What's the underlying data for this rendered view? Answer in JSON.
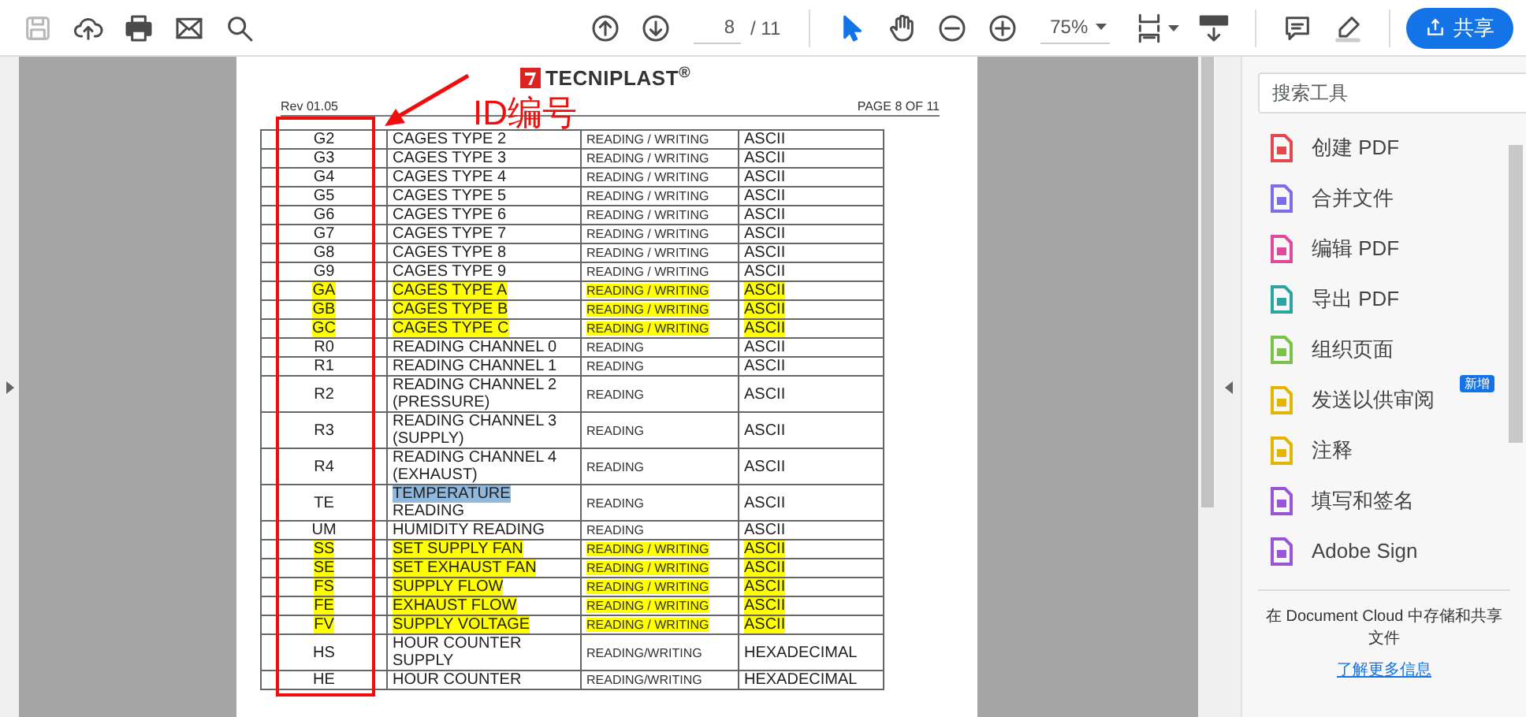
{
  "toolbar": {
    "save": {
      "disabled": true
    },
    "modes": [
      {
        "kind": "pointer",
        "selected": true
      },
      {
        "kind": "hand",
        "selected": false
      }
    ],
    "page_number": "8",
    "page_total": "/ 11",
    "zoom": "75%",
    "share": "共享"
  },
  "document": {
    "logo": "TECNIPLAST$^{®}$",
    "revision": "Rev 01.05",
    "page_label": "PAGE 8 OF 11",
    "annotation": {
      "label": "ID编号"
    },
    "rows": [
      {
        "id": "G2",
        "description": [
          "CAGES TYPE 2"
        ],
        "access": "READING / WRITING",
        "format": "ASCII",
        "highlighted": false,
        "text_selected": false
      },
      {
        "id": "G3",
        "description": [
          "CAGES TYPE 3"
        ],
        "access": "READING / WRITING",
        "format": "ASCII",
        "highlighted": false,
        "text_selected": false
      },
      {
        "id": "G4",
        "description": [
          "CAGES TYPE 4"
        ],
        "access": "READING / WRITING",
        "format": "ASCII",
        "highlighted": false,
        "text_selected": false
      },
      {
        "id": "G5",
        "description": [
          "CAGES TYPE 5"
        ],
        "access": "READING / WRITING",
        "format": "ASCII",
        "highlighted": false,
        "text_selected": false
      },
      {
        "id": "G6",
        "description": [
          "CAGES TYPE 6"
        ],
        "access": "READING / WRITING",
        "format": "ASCII",
        "highlighted": false,
        "text_selected": false
      },
      {
        "id": "G7",
        "description": [
          "CAGES TYPE 7"
        ],
        "access": "READING / WRITING",
        "format": "ASCII",
        "highlighted": false,
        "text_selected": false
      },
      {
        "id": "G8",
        "description": [
          "CAGES TYPE 8"
        ],
        "access": "READING / WRITING",
        "format": "ASCII",
        "highlighted": false,
        "text_selected": false
      },
      {
        "id": "G9",
        "description": [
          "CAGES TYPE 9"
        ],
        "access": "READING / WRITING",
        "format": "ASCII",
        "highlighted": false,
        "text_selected": false
      },
      {
        "id": "GA",
        "description": [
          "CAGES TYPE A"
        ],
        "access": "READING / WRITING",
        "format": "ASCII",
        "highlighted": true,
        "text_selected": false
      },
      {
        "id": "GB",
        "description": [
          "CAGES TYPE B"
        ],
        "access": "READING / WRITING",
        "format": "ASCII",
        "highlighted": true,
        "text_selected": false
      },
      {
        "id": "GC",
        "description": [
          "CAGES TYPE C"
        ],
        "access": "READING / WRITING",
        "format": "ASCII",
        "highlighted": true,
        "text_selected": false
      },
      {
        "id": "R0",
        "description": [
          "READING CHANNEL 0"
        ],
        "access": "READING",
        "format": "ASCII",
        "highlighted": false,
        "text_selected": false
      },
      {
        "id": "R1",
        "description": [
          "READING CHANNEL 1"
        ],
        "access": "READING",
        "format": "ASCII",
        "highlighted": false,
        "text_selected": false
      },
      {
        "id": "R2",
        "description": [
          "READING CHANNEL 2",
          "(PRESSURE)"
        ],
        "access": "READING",
        "format": "ASCII",
        "highlighted": false,
        "text_selected": false
      },
      {
        "id": "R3",
        "description": [
          "READING CHANNEL 3",
          "(SUPPLY)"
        ],
        "access": "READING",
        "format": "ASCII",
        "highlighted": false,
        "text_selected": false
      },
      {
        "id": "R4",
        "description": [
          "READING CHANNEL 4",
          "(EXHAUST)"
        ],
        "access": "READING",
        "format": "ASCII",
        "highlighted": false,
        "text_selected": false
      },
      {
        "id": "TE",
        "description": [
          "TEMPERATURE",
          "READING"
        ],
        "access": "READING",
        "format": "ASCII",
        "highlighted": false,
        "text_selected": true
      },
      {
        "id": "UM",
        "description": [
          "HUMIDITY READING"
        ],
        "access": "READING",
        "format": "ASCII",
        "highlighted": false,
        "text_selected": false
      },
      {
        "id": "SS",
        "description": [
          "SET SUPPLY FAN"
        ],
        "access": "READING / WRITING",
        "format": "ASCII",
        "highlighted": true,
        "text_selected": false
      },
      {
        "id": "SE",
        "description": [
          "SET EXHAUST FAN"
        ],
        "access": "READING / WRITING",
        "format": "ASCII",
        "highlighted": true,
        "text_selected": false
      },
      {
        "id": "FS",
        "description": [
          "SUPPLY FLOW"
        ],
        "access": "READING / WRITING",
        "format": "ASCII",
        "highlighted": true,
        "text_selected": false
      },
      {
        "id": "FE",
        "description": [
          "EXHAUST FLOW"
        ],
        "access": "READING / WRITING",
        "format": "ASCII",
        "highlighted": true,
        "text_selected": false
      },
      {
        "id": "FV",
        "description": [
          "SUPPLY VOLTAGE"
        ],
        "access": "READING / WRITING",
        "format": "ASCII",
        "highlighted": true,
        "text_selected": false
      },
      {
        "id": "HS",
        "description": [
          "HOUR COUNTER",
          "SUPPLY"
        ],
        "access": "READING/WRITING",
        "format": "HEXADECIMAL",
        "highlighted": false,
        "text_selected": false
      },
      {
        "id": "HE",
        "description": [
          "HOUR COUNTER"
        ],
        "access": "READING/WRITING",
        "format": "HEXADECIMAL",
        "highlighted": false,
        "text_selected": false
      }
    ]
  },
  "tools_panel": {
    "search": {
      "placeholder": "搜索工具"
    },
    "tools": [
      {
        "label": "创建 PDF",
        "color": "#e34850"
      },
      {
        "label": "合并文件",
        "color": "#7b6ce8"
      },
      {
        "label": "编辑 PDF",
        "color": "#df4a9a"
      },
      {
        "label": "导出 PDF",
        "color": "#2aa5a0"
      },
      {
        "label": "组织页面",
        "color": "#7cc14a"
      },
      {
        "label": "发送以供审阅",
        "color": "#e5b400",
        "badge": "新增"
      },
      {
        "label": "注释",
        "color": "#e5b400"
      },
      {
        "label": "填写和签名",
        "color": "#9656d6"
      },
      {
        "label": "Adobe Sign",
        "color": "#9656d6"
      }
    ],
    "footer": "在 Document Cloud 中存储和共享文件",
    "link": "了解更多信息"
  }
}
